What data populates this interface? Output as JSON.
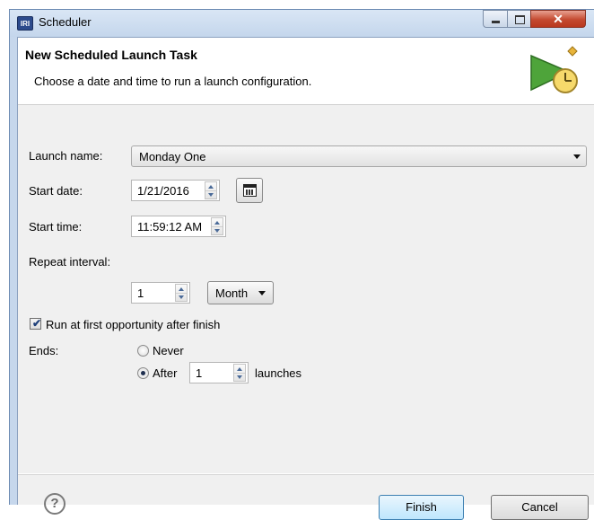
{
  "window": {
    "title": "Scheduler",
    "app_icon": "IRI"
  },
  "banner": {
    "title": "New Scheduled Launch Task",
    "description": "Choose a date and time to run a launch configuration."
  },
  "form": {
    "launch_name": {
      "label": "Launch name:",
      "value": "Monday One"
    },
    "start_date": {
      "label": "Start date:",
      "value": "1/21/2016"
    },
    "start_time": {
      "label": "Start time:",
      "value": "11:59:12 AM"
    },
    "repeat_interval": {
      "label": "Repeat interval:",
      "value": "1",
      "unit": "Month"
    },
    "run_first": {
      "label": "Run at first opportunity after finish",
      "checked": true
    },
    "ends": {
      "label": "Ends:",
      "never_label": "Never",
      "after_label": "After",
      "after_value": "1",
      "launches_label": "launches",
      "selected": "after"
    }
  },
  "buttons": {
    "finish": "Finish",
    "cancel": "Cancel",
    "help": "?"
  },
  "colors": {
    "accent": "#3c7fb1",
    "close": "#c44a30"
  }
}
